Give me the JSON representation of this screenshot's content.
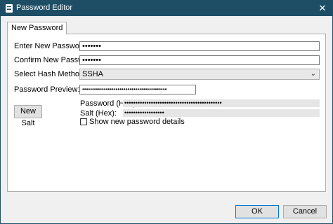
{
  "window": {
    "title": "Password Editor",
    "close_glyph": "✕"
  },
  "tabs": [
    {
      "label": "New Password"
    }
  ],
  "form": {
    "enter_label": "Enter New Password:",
    "enter_value": "•••••••",
    "confirm_label": "Confirm New Password:",
    "confirm_value": "•••••••",
    "hash_label": "Select Hash Method:",
    "hash_value": "SSHA",
    "preview_label": "Password Preview:",
    "preview_value": "•••••••••••••••••••••••••••••••••••••••••••",
    "hex_label": "Password (Hex):",
    "hex_value": "••••••••••••••••••••••••••••••••••••••••••••",
    "salt_label": "Salt (Hex):",
    "salt_value": "••••••••••••••••••",
    "new_salt_label": "New Salt",
    "show_details_label": "Show new password details",
    "show_details_checked": false
  },
  "footer": {
    "ok_label": "OK",
    "cancel_label": "Cancel"
  },
  "icons": {
    "title": "document-icon",
    "dropdown": "chevron-down-icon",
    "close": "close-icon"
  },
  "colors": {
    "titlebar": "#1e4e66",
    "accent": "#0078d7"
  }
}
